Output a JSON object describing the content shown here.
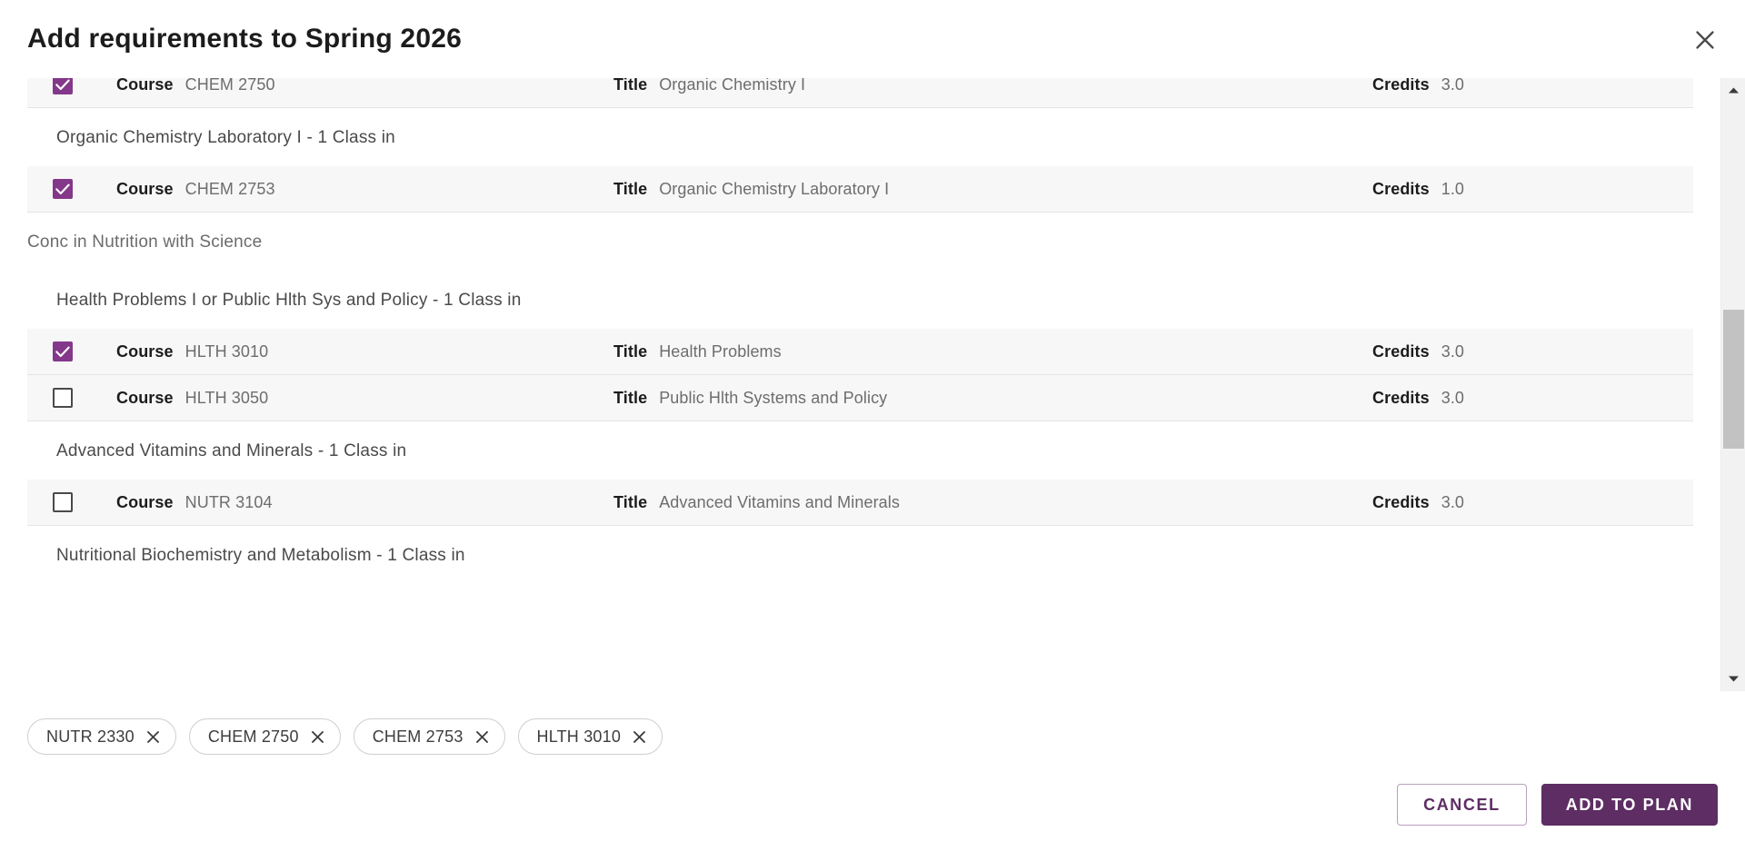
{
  "dialog": {
    "title": "Add requirements to Spring 2026",
    "close_icon": "close-icon"
  },
  "columns": {
    "course": "Course",
    "title": "Title",
    "credits": "Credits"
  },
  "content": [
    {
      "kind": "course",
      "clipped": true,
      "checked": true,
      "code": "CHEM 2750",
      "title": "Organic Chemistry I",
      "credits": "3.0"
    },
    {
      "kind": "requirement",
      "label": "Organic Chemistry Laboratory I - 1 Class in"
    },
    {
      "kind": "course",
      "clipped": false,
      "checked": true,
      "code": "CHEM 2753",
      "title": "Organic Chemistry Laboratory I",
      "credits": "1.0"
    },
    {
      "kind": "group",
      "label": "Conc in Nutrition with Science"
    },
    {
      "kind": "requirement",
      "label": "Health Problems I or Public Hlth Sys and Policy - 1 Class in"
    },
    {
      "kind": "course",
      "clipped": false,
      "checked": true,
      "code": "HLTH 3010",
      "title": "Health Problems",
      "credits": "3.0"
    },
    {
      "kind": "course",
      "clipped": false,
      "checked": false,
      "code": "HLTH 3050",
      "title": "Public Hlth Systems and Policy",
      "credits": "3.0"
    },
    {
      "kind": "requirement",
      "label": "Advanced Vitamins and Minerals - 1 Class in"
    },
    {
      "kind": "course",
      "clipped": false,
      "checked": false,
      "code": "NUTR 3104",
      "title": "Advanced Vitamins and Minerals",
      "credits": "3.0"
    },
    {
      "kind": "requirement",
      "label": "Nutritional Biochemistry and Metabolism - 1 Class in"
    }
  ],
  "scrollbar": {
    "up_icon": "chevron-up-icon",
    "down_icon": "chevron-down-icon"
  },
  "chips": [
    {
      "label": "NUTR 2330",
      "remove_icon": "close-icon"
    },
    {
      "label": "CHEM 2750",
      "remove_icon": "close-icon"
    },
    {
      "label": "CHEM 2753",
      "remove_icon": "close-icon"
    },
    {
      "label": "HLTH 3010",
      "remove_icon": "close-icon"
    }
  ],
  "footer": {
    "cancel_label": "CANCEL",
    "submit_label": "ADD TO PLAN"
  },
  "colors": {
    "accent": "#5d2d63",
    "checkbox_checked": "#84388a",
    "row_bg": "#f7f7f7",
    "scroll_thumb": "#c2c2c2"
  }
}
